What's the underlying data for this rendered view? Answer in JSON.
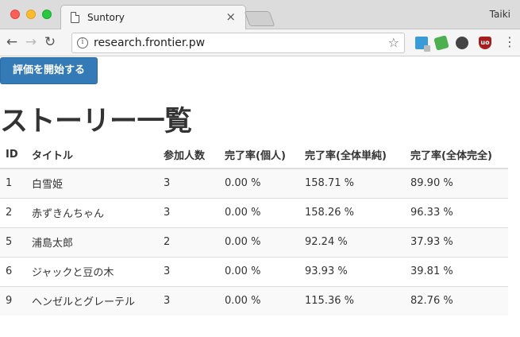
{
  "browser": {
    "tab_title": "Suntory",
    "user_name": "Taiki",
    "url": "research.frontier.pw",
    "info_glyph": "i",
    "close_glyph": "×",
    "star_glyph": "☆",
    "back_glyph": "←",
    "forward_glyph": "→",
    "reload_glyph": "↻",
    "menu_glyph": "⋮",
    "ublock_label": "uo",
    "traffic_colors": {
      "close": "#fc5f57",
      "minimize": "#fdbc2e",
      "zoom": "#28c840"
    }
  },
  "page": {
    "start_button_label": "評価を開始する",
    "title": "ストーリー一覧",
    "accent_color": "#337ab7"
  },
  "table": {
    "headers": {
      "id": "ID",
      "title": "タイトル",
      "participants": "参加人数",
      "personal": "完了率(個人)",
      "simple": "完了率(全体単純)",
      "full": "完了率(全体完全)"
    },
    "rows": [
      {
        "id": "1",
        "title": "白雪姫",
        "participants": "3",
        "personal": "0.00 %",
        "simple": "158.71 %",
        "full": "89.90 %"
      },
      {
        "id": "2",
        "title": "赤ずきんちゃん",
        "participants": "3",
        "personal": "0.00 %",
        "simple": "158.26 %",
        "full": "96.33 %"
      },
      {
        "id": "5",
        "title": "浦島太郎",
        "participants": "2",
        "personal": "0.00 %",
        "simple": "92.24 %",
        "full": "37.93 %"
      },
      {
        "id": "6",
        "title": "ジャックと豆の木",
        "participants": "3",
        "personal": "0.00 %",
        "simple": "93.93 %",
        "full": "39.81 %"
      },
      {
        "id": "9",
        "title": "ヘンゼルとグレーテル",
        "participants": "3",
        "personal": "0.00 %",
        "simple": "115.36 %",
        "full": "82.76 %"
      }
    ]
  },
  "extensions": [
    "translate-extension-icon",
    "evernote-extension-icon",
    "dark-extension-icon",
    "ublock-origin-icon"
  ]
}
